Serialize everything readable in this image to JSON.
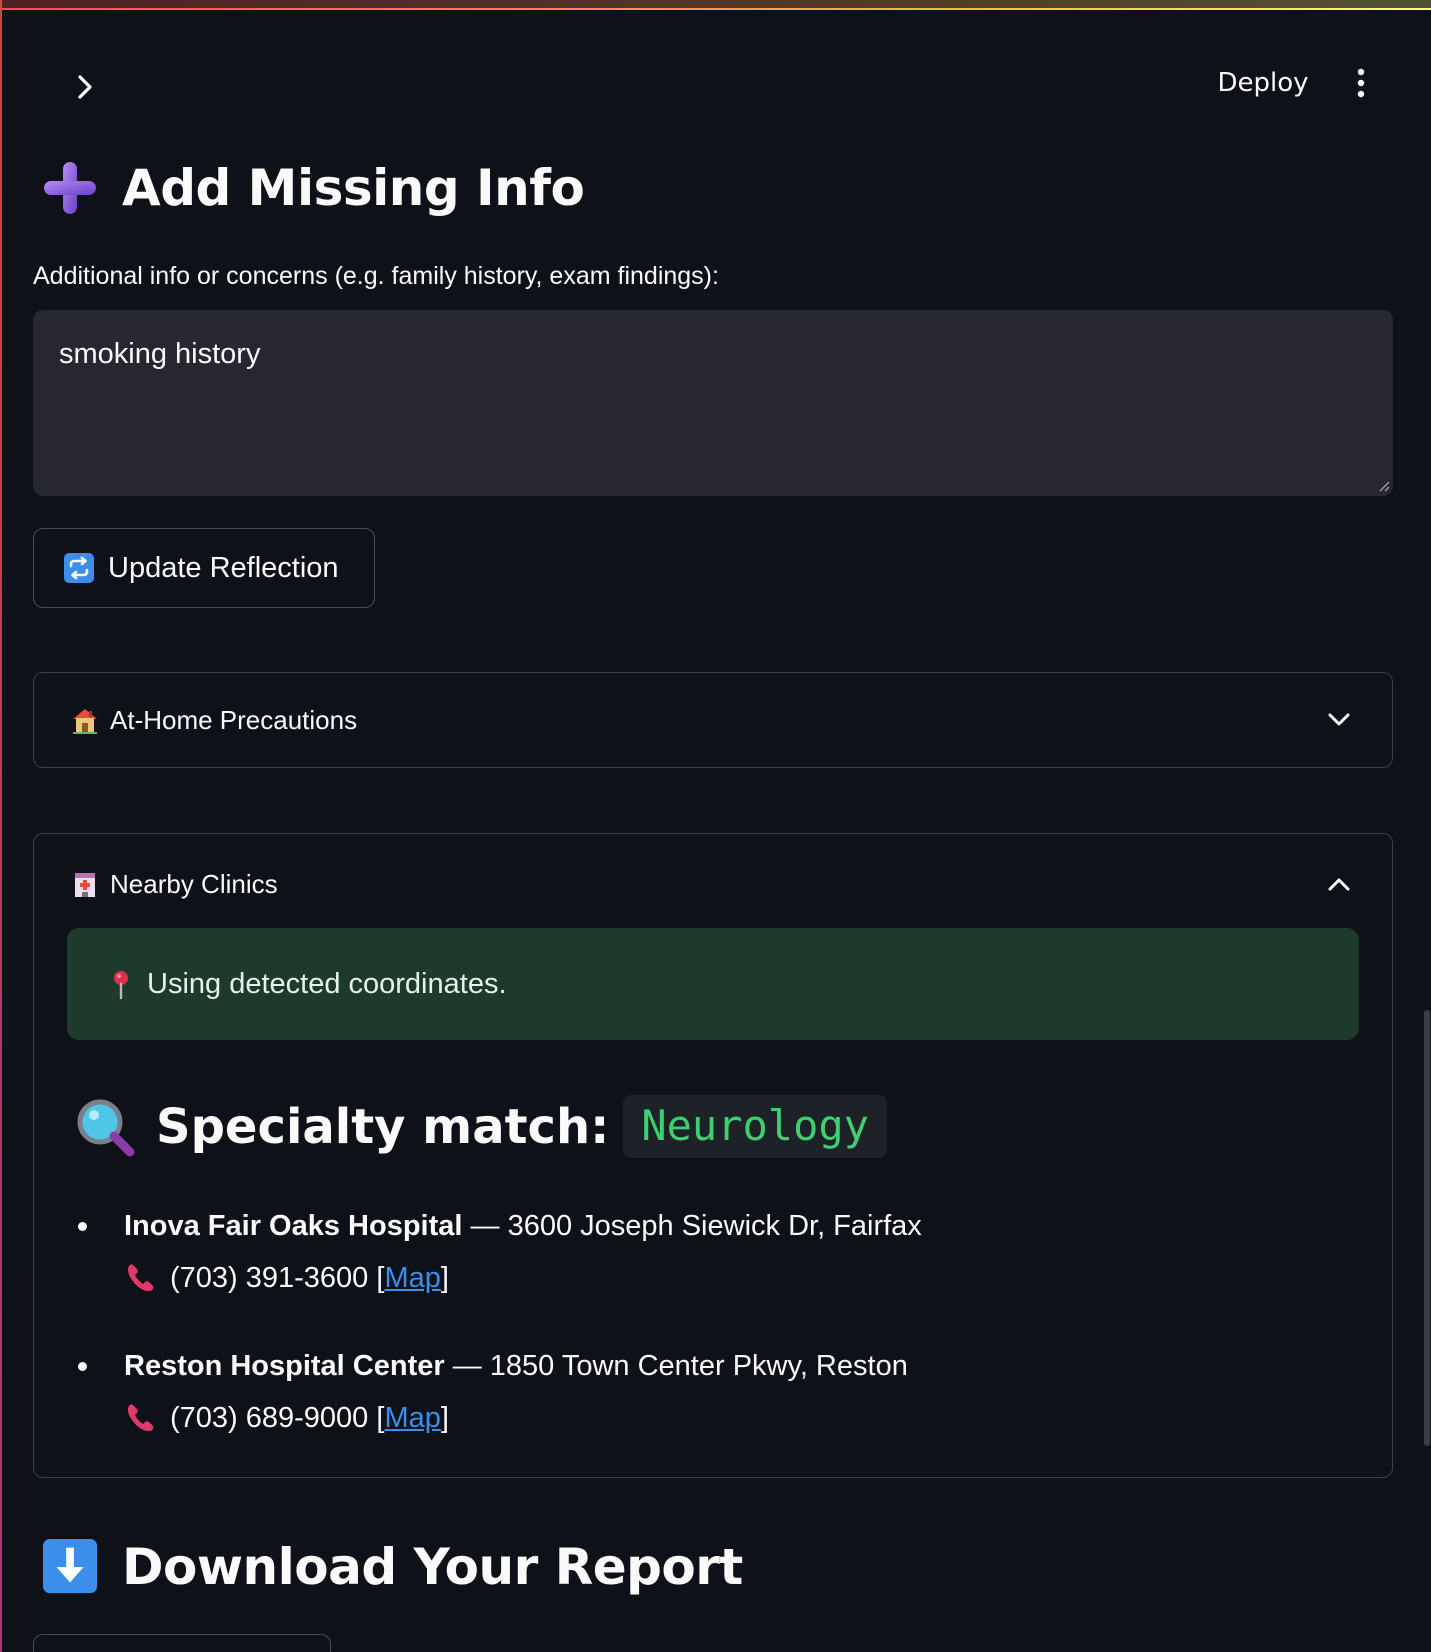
{
  "header": {
    "deploy_label": "Deploy",
    "sidebar_toggle_icon": "chevron-right-icon",
    "menu_icon": "more-vertical-icon"
  },
  "add_missing_info": {
    "title": "Add Missing Info",
    "icon": "plus-icon",
    "field_label": "Additional info or concerns (e.g. family history, exam findings):",
    "field_value": "smoking history"
  },
  "update_button": {
    "label": "Update Reflection",
    "icon": "repeat-icon"
  },
  "at_home": {
    "label": "At-Home Precautions",
    "icon": "house-icon",
    "expanded": false
  },
  "nearby": {
    "label": "Nearby Clinics",
    "icon": "hospital-icon",
    "expanded": true,
    "info": "Using detected coordinates.",
    "info_icon": "pin-icon",
    "specialty_prefix": "Specialty match:",
    "specialty": "Neurology",
    "clinics": [
      {
        "name": "Inova Fair Oaks Hospital",
        "address": " — 3600 Joseph Siewick Dr, Fairfax",
        "phone": "(703) 391-3600",
        "open": " [",
        "map_label": "Map",
        "close": "]"
      },
      {
        "name": "Reston Hospital Center",
        "address": " — 1850 Town Center Pkwy, Reston",
        "phone": "(703) 689-9000",
        "open": " [",
        "map_label": "Map",
        "close": "]"
      }
    ]
  },
  "download": {
    "title": "Download Your Report",
    "icon": "down-arrow-icon"
  },
  "colors": {
    "background": "#0e1117",
    "input_bg": "#262730",
    "info_bg": "#1e3a2c",
    "code_green": "#3ecf6f",
    "link_blue": "#3b8eea"
  }
}
